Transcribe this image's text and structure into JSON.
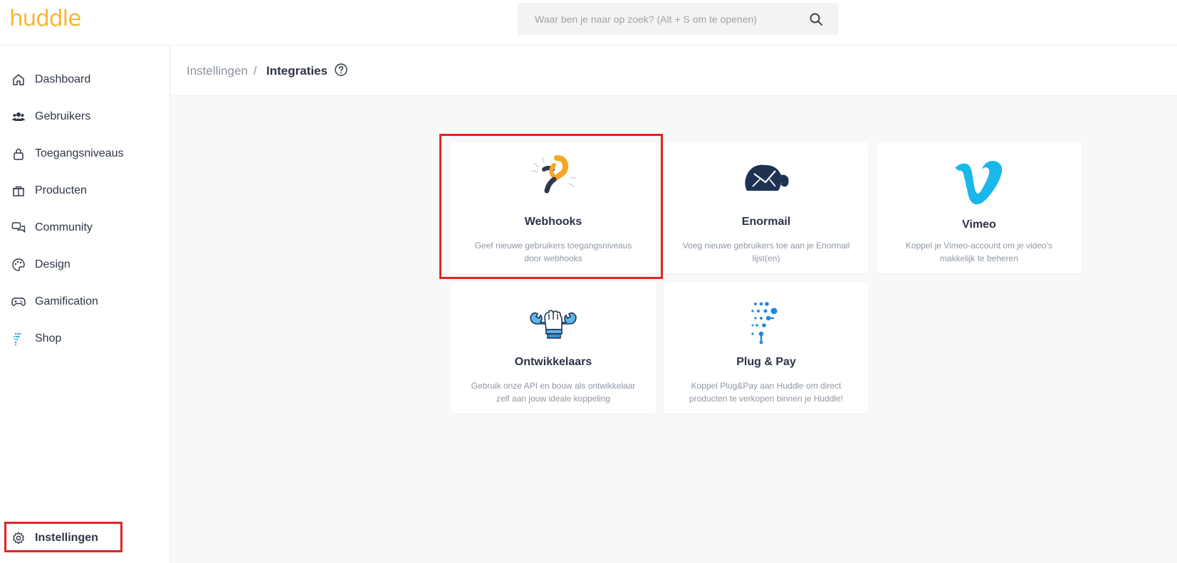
{
  "app": {
    "logo_text": "huddle",
    "brand_color": "#f7b733"
  },
  "search": {
    "placeholder": "Waar ben je naar op zoek? (Alt + S om te openen)",
    "value": "",
    "icon": "search-icon"
  },
  "sidebar": {
    "items": [
      {
        "label": "Dashboard",
        "icon": "home-icon"
      },
      {
        "label": "Gebruikers",
        "icon": "users-icon"
      },
      {
        "label": "Toegangsniveaus",
        "icon": "lock-icon"
      },
      {
        "label": "Producten",
        "icon": "box-icon"
      },
      {
        "label": "Community",
        "icon": "chat-icon"
      },
      {
        "label": "Design",
        "icon": "palette-icon"
      },
      {
        "label": "Gamification",
        "icon": "gamepad-icon"
      },
      {
        "label": "Shop",
        "icon": "shop-icon"
      }
    ],
    "settings": {
      "label": "Instellingen",
      "icon": "gear-icon",
      "active": true
    }
  },
  "breadcrumb": {
    "parent": "Instellingen",
    "separator": "/",
    "current": "Integraties",
    "help_icon": "help-icon"
  },
  "integrations": [
    {
      "title": "Webhooks",
      "description": "Geef nieuwe gebruikers toegangsniveaus door webhooks",
      "icon": "webhook-icon"
    },
    {
      "title": "Enormail",
      "description": "Voeg nieuwe gebruikers toe aan je Enormail lijst(en)",
      "icon": "elephant-icon"
    },
    {
      "title": "Vimeo",
      "description": "Koppel je Vimeo-account om je video's makkelijk te beheren",
      "icon": "vimeo-icon"
    },
    {
      "title": "Ontwikkelaars",
      "description": "Gebruik onze API en bouw als ontwikkelaar zelf aan jouw ideale koppeling",
      "icon": "wrench-hand-icon"
    },
    {
      "title": "Plug & Pay",
      "description": "Koppel Plug&Pay aan Huddle om direct producten te verkopen binnen je Huddle!",
      "icon": "plugandpay-icon"
    }
  ],
  "highlight_color": "#e12424"
}
